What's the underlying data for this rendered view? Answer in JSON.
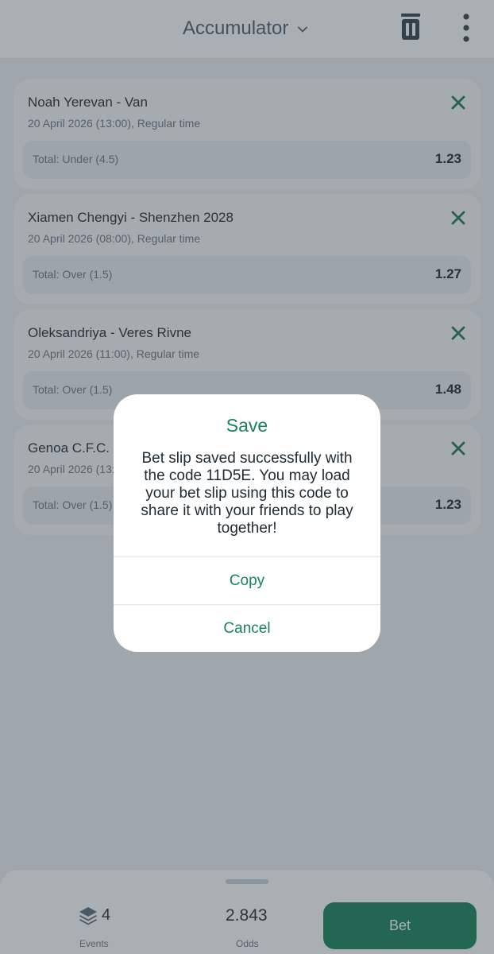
{
  "header": {
    "title": "Accumulator",
    "icons": {
      "dropdown": "chevron-down-icon",
      "clear": "trash-icon",
      "more": "more-vertical-icon"
    }
  },
  "bets": [
    {
      "match": "Noah Yerevan - Van",
      "date": "20 April 2026 (13:00), Regular time",
      "pick": "Total: Under (4.5)",
      "odds": "1.23"
    },
    {
      "match": "Xiamen Chengyi - Shenzhen 2028",
      "date": "20 April 2026 (08:00), Regular time",
      "pick": "Total: Over (1.5)",
      "odds": "1.27"
    },
    {
      "match": "Oleksandriya - Veres Rivne",
      "date": "20 April 2026 (11:00), Regular time",
      "pick": "Total: Over (1.5)",
      "odds": "1.48"
    },
    {
      "match": "Genoa C.F.C. U",
      "date": "20 April 2026 (13:",
      "pick": "Total: Over (1.5)",
      "odds": "1.23"
    }
  ],
  "footer": {
    "events_count": "4",
    "events_label": "Events",
    "odds_value": "2.843",
    "odds_label": "Odds",
    "bet_label": "Bet"
  },
  "dialog": {
    "title": "Save",
    "message": "Bet slip saved successfully with the code 11D5E. You may load your bet slip using this code to share it with your friends to play together!",
    "copy_label": "Copy",
    "cancel_label": "Cancel"
  },
  "colors": {
    "accent": "#17845a",
    "remove_icon": "#1f7a4f",
    "overlay": "#34404a"
  }
}
